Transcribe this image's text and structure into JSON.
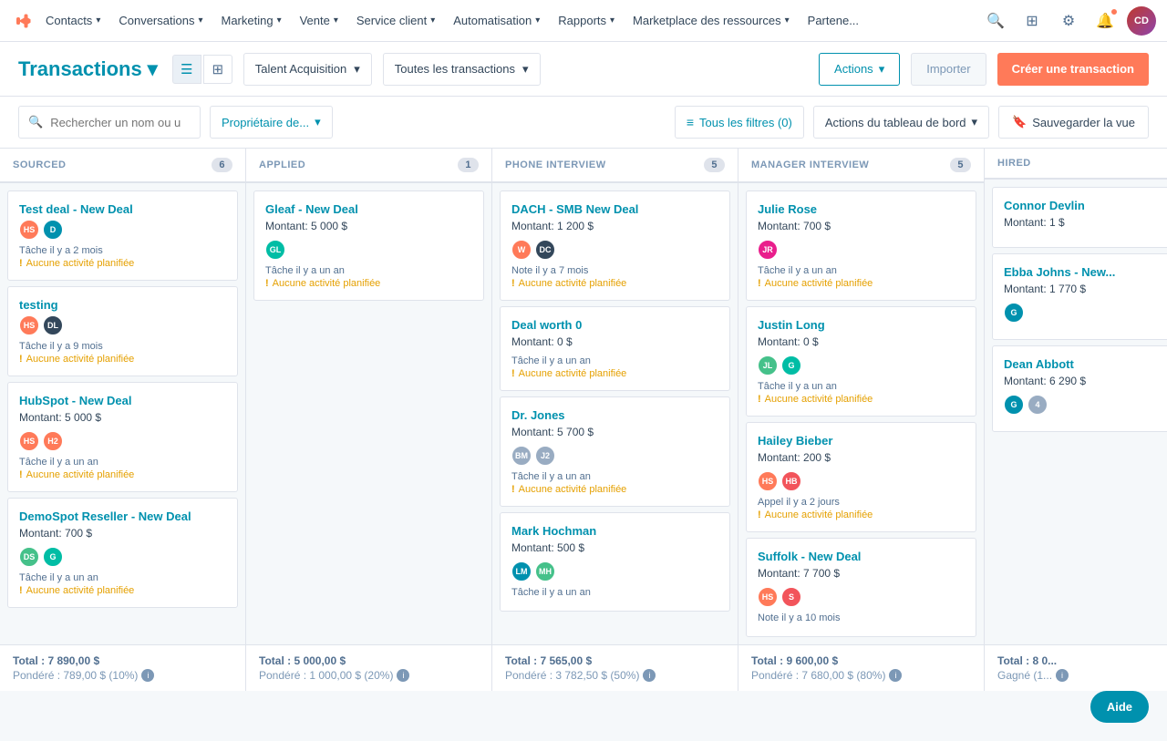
{
  "nav": {
    "logo": "⚙",
    "items": [
      {
        "label": "Contacts",
        "id": "contacts"
      },
      {
        "label": "Conversations",
        "id": "conversations"
      },
      {
        "label": "Marketing",
        "id": "marketing"
      },
      {
        "label": "Vente",
        "id": "vente"
      },
      {
        "label": "Service client",
        "id": "service"
      },
      {
        "label": "Automatisation",
        "id": "automatisation"
      },
      {
        "label": "Rapports",
        "id": "rapports"
      },
      {
        "label": "Marketplace des ressources",
        "id": "marketplace"
      },
      {
        "label": "Partene...",
        "id": "partene"
      }
    ]
  },
  "header": {
    "title": "Transactions",
    "view_list_label": "☰",
    "view_grid_label": "⊞",
    "pipeline_label": "Talent Acquisition",
    "filter_label": "Toutes les transactions",
    "actions_label": "Actions",
    "import_label": "Importer",
    "create_label": "Créer une transaction"
  },
  "filters": {
    "search_placeholder": "Rechercher un nom ou u",
    "owner_label": "Propriétaire de...",
    "all_filters_label": "Tous les filtres (0)",
    "board_actions_label": "Actions du tableau de bord",
    "save_view_label": "Sauvegarder la vue"
  },
  "columns": [
    {
      "id": "sourced",
      "name": "SOURCED",
      "count": 6,
      "cards": [
        {
          "title": "Test deal - New Deal",
          "amount": null,
          "avatars": [
            {
              "color": "av-orange",
              "initials": "HS"
            },
            {
              "color": "av-blue",
              "initials": "D"
            }
          ],
          "task": "Tâche il y a 2 mois",
          "no_activity": "Aucune activité planifiée"
        },
        {
          "title": "testing",
          "amount": null,
          "avatars": [
            {
              "color": "av-orange",
              "initials": "HS"
            },
            {
              "color": "av-dark",
              "initials": "DL"
            }
          ],
          "task": "Tâche il y a 9 mois",
          "no_activity": "Aucune activité planifiée"
        },
        {
          "title": "HubSpot - New Deal",
          "amount": "Montant: 5 000 $",
          "avatars": [
            {
              "color": "av-orange",
              "initials": "HS"
            },
            {
              "color": "av-orange",
              "initials": "H2"
            }
          ],
          "task": "Tâche il y a un an",
          "no_activity": "Aucune activité planifiée"
        },
        {
          "title": "DemoSpot Reseller - New Deal",
          "amount": "Montant: 700 $",
          "avatars": [
            {
              "color": "av-teal",
              "initials": "DS"
            },
            {
              "color": "av-green",
              "initials": "G"
            }
          ],
          "task": "Tâche il y a un an",
          "no_activity": "Aucune activité planifiée"
        }
      ],
      "total": "Total : 7 890,00 $",
      "weighted": "Pondéré : 789,00 $ (10%)"
    },
    {
      "id": "applied",
      "name": "APPLIED",
      "count": 1,
      "cards": [
        {
          "title": "Gleaf - New Deal",
          "amount": "Montant: 5 000 $",
          "avatars": [
            {
              "color": "av-green",
              "initials": "GL",
              "img": true
            }
          ],
          "task": "Tâche il y a un an",
          "no_activity": "Aucune activité planifiée"
        }
      ],
      "total": "Total : 5 000,00 $",
      "weighted": "Pondéré : 1 000,00 $ (20%)"
    },
    {
      "id": "phone_interview",
      "name": "PHONE INTERVIEW",
      "count": 5,
      "cards": [
        {
          "title": "DACH - SMB New Deal",
          "amount": "Montant: 1 200 $",
          "avatars": [
            {
              "color": "av-orange",
              "initials": "W"
            },
            {
              "color": "av-dark",
              "initials": "DC"
            }
          ],
          "task": "Note il y a 7 mois",
          "no_activity": "Aucune activité planifiée"
        },
        {
          "title": "Deal worth 0",
          "amount": "Montant: 0 $",
          "avatars": [],
          "task": "Tâche il y a un an",
          "no_activity": "Aucune activité planifiée"
        },
        {
          "title": "Dr. Jones",
          "amount": "Montant: 5 700 $",
          "avatars": [
            {
              "color": "av-gray",
              "initials": "BM"
            },
            {
              "color": "av-gray",
              "initials": "J2"
            }
          ],
          "task": "Tâche il y a un an",
          "no_activity": "Aucune activité planifiée"
        },
        {
          "title": "Mark Hochman",
          "amount": "Montant: 500 $",
          "avatars": [
            {
              "color": "av-blue",
              "initials": "LM"
            },
            {
              "color": "av-teal",
              "initials": "MH"
            }
          ],
          "task": "Tâche il y a un an",
          "no_activity": null
        }
      ],
      "total": "Total : 7 565,00 $",
      "weighted": "Pondéré : 3 782,50 $ (50%)"
    },
    {
      "id": "manager_interview",
      "name": "MANAGER INTERVIEW",
      "count": 5,
      "cards": [
        {
          "title": "Julie Rose",
          "amount": "Montant: 700 $",
          "avatars": [
            {
              "color": "av-pink",
              "initials": "JR"
            }
          ],
          "task": "Tâche il y a un an",
          "no_activity": "Aucune activité planifiée"
        },
        {
          "title": "Justin Long",
          "amount": "Montant: 0 $",
          "avatars": [
            {
              "color": "av-teal",
              "initials": "JL"
            },
            {
              "color": "av-green",
              "initials": "G"
            }
          ],
          "task": "Tâche il y a un an",
          "no_activity": "Aucune activité planifiée"
        },
        {
          "title": "Hailey Bieber",
          "amount": "Montant: 200 $",
          "avatars": [
            {
              "color": "av-orange",
              "initials": "HS"
            },
            {
              "color": "av-red",
              "initials": "HB"
            }
          ],
          "task": "Appel il y a 2 jours",
          "no_activity": "Aucune activité planifiée"
        },
        {
          "title": "Suffolk - New Deal",
          "amount": "Montant: 7 700 $",
          "avatars": [
            {
              "color": "av-orange",
              "initials": "HS"
            },
            {
              "color": "av-red",
              "initials": "S"
            }
          ],
          "task": "Note il y a 10 mois",
          "no_activity": null
        }
      ],
      "total": "Total : 9 600,00 $",
      "weighted": "Pondéré : 7 680,00 $ (80%)"
    },
    {
      "id": "hired",
      "name": "HIRED",
      "count": null,
      "cards": [
        {
          "title": "Connor Devlin",
          "amount": "Montant: 1 $",
          "avatars": [],
          "task": null,
          "no_activity": null
        },
        {
          "title": "Ebba Johns - New...",
          "amount": "Montant: 1 770 $",
          "avatars": [
            {
              "color": "av-blue",
              "initials": "G"
            }
          ],
          "task": null,
          "no_activity": null
        },
        {
          "title": "Dean Abbott",
          "amount": "Montant: 6 290 $",
          "avatars": [
            {
              "color": "av-blue",
              "initials": "G"
            },
            {
              "color": "av-gray",
              "initials": "4"
            }
          ],
          "task": null,
          "no_activity": null
        }
      ],
      "total": "Total : 8 0...",
      "weighted": "Gagné (1..."
    }
  ],
  "aide": {
    "label": "Aide"
  }
}
